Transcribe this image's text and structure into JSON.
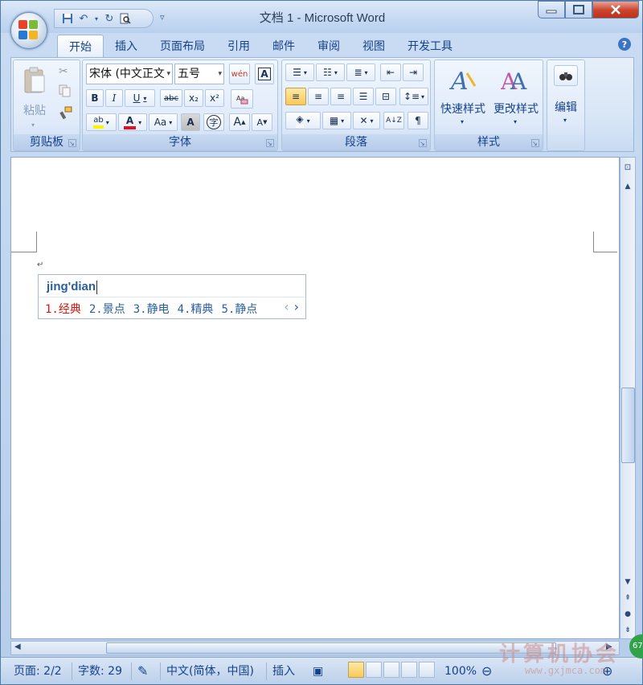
{
  "window": {
    "title": "文档 1 - Microsoft Word"
  },
  "tabs": [
    "开始",
    "插入",
    "页面布局",
    "引用",
    "邮件",
    "审阅",
    "视图",
    "开发工具"
  ],
  "ribbon": {
    "clipboard": {
      "label": "剪贴板",
      "paste": "粘贴"
    },
    "font": {
      "label": "字体",
      "font_name": "宋体 (中文正文",
      "font_size": "五号",
      "bold": "B",
      "italic": "I",
      "underline": "U",
      "strikethrough": "abc",
      "subscript": "x₂",
      "superscript": "x²",
      "change_case": "Aa",
      "grow": "A",
      "shrink": "A",
      "phonetic": "wén",
      "char_border": "A",
      "enclose": "字"
    },
    "paragraph": {
      "label": "段落"
    },
    "styles": {
      "label": "样式",
      "quick_styles": "快速样式",
      "change_styles": "更改样式"
    },
    "editing": {
      "label": "编辑"
    }
  },
  "ime": {
    "input": "jing'dian",
    "candidates": [
      "1.经典",
      "2.景点",
      "3.静电",
      "4.精典",
      "5.静点"
    ]
  },
  "status": {
    "page": "页面: 2/2",
    "words": "字数: 29",
    "language": "中文(简体，中国)",
    "mode": "插入",
    "zoom": "100%"
  },
  "watermark": {
    "title": "计算机协会",
    "url": "www.gxjmca.com",
    "badge": "67"
  },
  "colors": {
    "accent": "#15428b",
    "ribbon_bg": "#dfeafa",
    "ime_highlight": "#d4160c",
    "ime_text": "#2a5f9e",
    "highlight_yellow": "#fff200",
    "font_red": "#e3101e"
  }
}
